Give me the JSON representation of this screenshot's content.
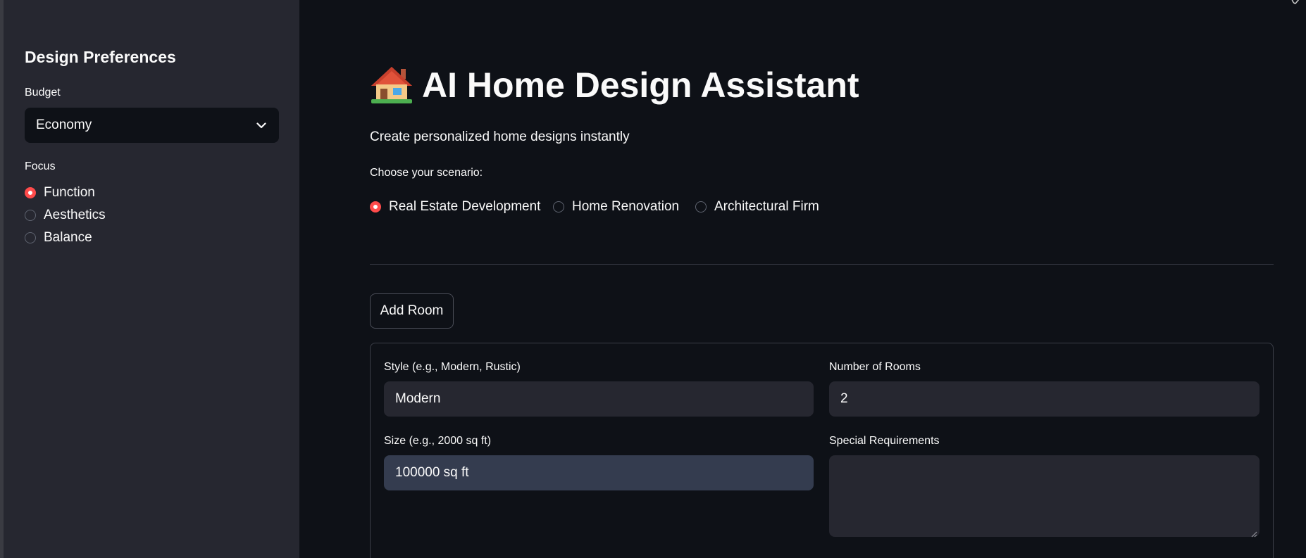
{
  "sidebar": {
    "heading": "Design Preferences",
    "budget": {
      "label": "Budget",
      "selected": "Economy"
    },
    "focus": {
      "label": "Focus",
      "options": [
        "Function",
        "Aesthetics",
        "Balance"
      ],
      "selected_index": 0
    }
  },
  "main": {
    "title_emoji": "house-icon",
    "title": "AI Home Design Assistant",
    "subtitle": "Create personalized home designs instantly",
    "scenario": {
      "label": "Choose your scenario:",
      "options": [
        "Real Estate Development",
        "Home Renovation",
        "Architectural Firm"
      ],
      "selected_index": 0
    },
    "add_room_label": "Add Room",
    "form": {
      "style": {
        "label": "Style (e.g., Modern, Rustic)",
        "value": "Modern"
      },
      "rooms": {
        "label": "Number of Rooms",
        "value": "2"
      },
      "size": {
        "label": "Size (e.g., 2000 sq ft)",
        "value": "100000 sq ft"
      },
      "requirements": {
        "label": "Special Requirements",
        "value": ""
      }
    }
  },
  "colors": {
    "background": "#0e1117",
    "sidebar": "#262730",
    "accent": "#ff4b4b",
    "input_bg": "#262730",
    "input_active_bg": "#343c4f"
  }
}
